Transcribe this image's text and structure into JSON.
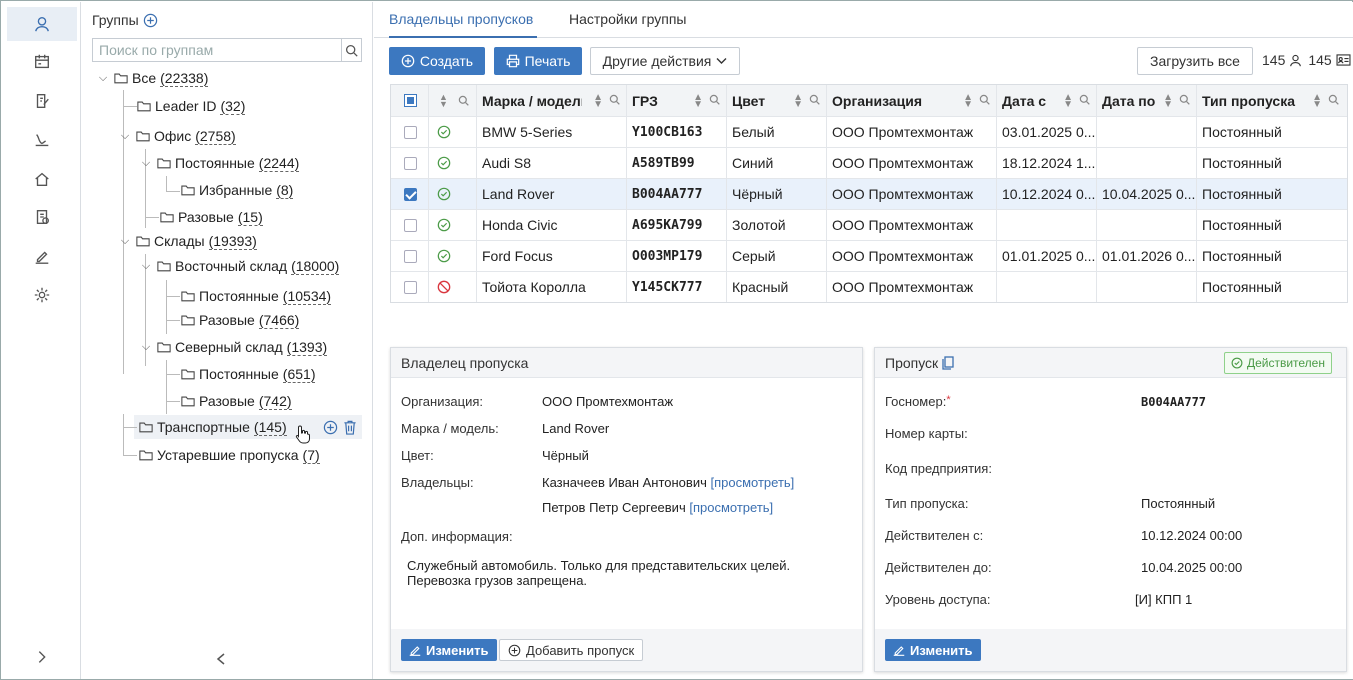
{
  "sidebar_icons": [
    "user-icon",
    "calendar-pass-icon",
    "document-edit-icon",
    "sign-icon",
    "home-icon",
    "document-check-icon",
    "pen-icon",
    "gear-icon"
  ],
  "groups": {
    "title": "Группы",
    "search_placeholder": "Поиск по группам",
    "tree": [
      {
        "label": "Все",
        "count": "(22338)"
      },
      {
        "label": "Leader ID",
        "count": "(32)"
      },
      {
        "label": "Офис",
        "count": "(2758)"
      },
      {
        "label": "Постоянные",
        "count": "(2244)"
      },
      {
        "label": "Избранные",
        "count": "(8)"
      },
      {
        "label": "Разовые",
        "count": "(15)"
      },
      {
        "label": "Склады",
        "count": "(19393)"
      },
      {
        "label": "Восточный склад",
        "count": "(18000)"
      },
      {
        "label": "Постоянные",
        "count": "(10534)"
      },
      {
        "label": "Разовые",
        "count": "(7466)"
      },
      {
        "label": "Северный склад",
        "count": "(1393)"
      },
      {
        "label": "Постоянные",
        "count": "(651)"
      },
      {
        "label": "Разовые",
        "count": "(742)"
      },
      {
        "label": "Транспортные",
        "count": "(145)"
      },
      {
        "label": "Устаревшие пропуска",
        "count": "(7)"
      }
    ]
  },
  "tabs": [
    {
      "label": "Владельцы пропусков",
      "active": true
    },
    {
      "label": "Настройки группы",
      "active": false
    }
  ],
  "toolbar": {
    "create": "Создать",
    "print": "Печать",
    "other_actions": "Другие действия",
    "load_all": "Загрузить все",
    "count_users": "145",
    "count_cards": "145"
  },
  "grid": {
    "columns": [
      "Марка / модель",
      "ГРЗ",
      "Цвет",
      "Организация",
      "Дата с",
      "Дата по",
      "Тип пропуска"
    ],
    "rows": [
      {
        "status": "ok",
        "model": "BMW 5-Series",
        "plate": "Y100CB163",
        "color": "Белый",
        "org": "ООО Промтехмонтаж",
        "from": "03.01.2025 0...",
        "to": "",
        "type": "Постоянный",
        "checked": false
      },
      {
        "status": "ok",
        "model": "Audi S8",
        "plate": "A589TB99",
        "color": "Синий",
        "org": "ООО Промтехмонтаж",
        "from": "18.12.2024 1...",
        "to": "",
        "type": "Постоянный",
        "checked": false
      },
      {
        "status": "ok",
        "model": "Land Rover",
        "plate": "B004AA777",
        "color": "Чёрный",
        "org": "ООО Промтехмонтаж",
        "from": "10.12.2024 0...",
        "to": "10.04.2025 0...",
        "type": "Постоянный",
        "checked": true
      },
      {
        "status": "ok",
        "model": "Honda Civic",
        "plate": "A695KA799",
        "color": "Золотой",
        "org": "ООО Промтехмонтаж",
        "from": "",
        "to": "",
        "type": "Постоянный",
        "checked": false
      },
      {
        "status": "ok",
        "model": "Ford Focus",
        "plate": "O003MP179",
        "color": "Серый",
        "org": "ООО Промтехмонтаж",
        "from": "01.01.2025 0...",
        "to": "01.01.2026 0...",
        "type": "Постоянный",
        "checked": false
      },
      {
        "status": "blocked",
        "model": "Тойота Королла",
        "plate": "Y145CK777",
        "color": "Красный",
        "org": "ООО Промтехмонтаж",
        "from": "",
        "to": "",
        "type": "Постоянный",
        "checked": false
      }
    ]
  },
  "owner_panel": {
    "title": "Владелец пропуска",
    "org_label": "Организация:",
    "org_value": "ООО Промтехмонтаж",
    "model_label": "Марка / модель:",
    "model_value": "Land Rover",
    "color_label": "Цвет:",
    "color_value": "Чёрный",
    "owners_label": "Владельцы:",
    "owner1": "Казначеев Иван Антонович",
    "owner2": "Петров Петр Сергеевич",
    "view_link": "[просмотреть]",
    "info_label": "Доп. информация:",
    "info_line1": "Служебный автомобиль. Только для представительских целей.",
    "info_line2": "Перевозка грузов запрещена.",
    "edit": "Изменить",
    "add_pass": "Добавить пропуск"
  },
  "pass_panel": {
    "title": "Пропуск",
    "status": "Действителен",
    "plate_label": "Госномер:",
    "plate_value": "B004AA777",
    "card_label": "Номер карты:",
    "company_code_label": "Код предприятия:",
    "type_label": "Тип пропуска:",
    "type_value": "Постоянный",
    "from_label": "Действителен с:",
    "from_value": "10.12.2024 00:00",
    "to_label": "Действителен до:",
    "to_value": "10.04.2025 00:00",
    "access_label": "Уровень доступа:",
    "access_value": "[И] КПП 1",
    "edit": "Изменить"
  },
  "colors": {
    "accent": "#3c78c0",
    "valid": "#4a9a46",
    "blocked": "#d9363e"
  }
}
